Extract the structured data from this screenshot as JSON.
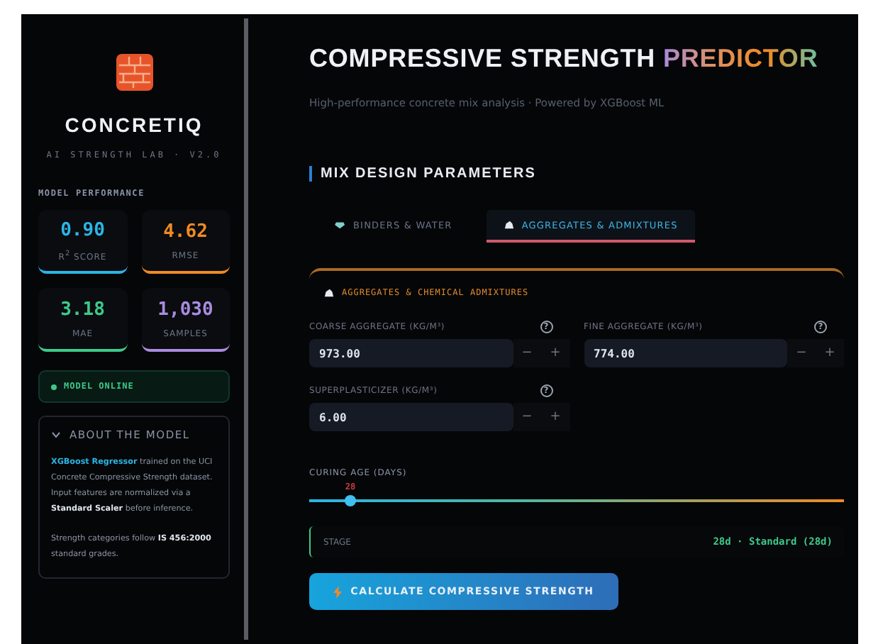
{
  "sidebar": {
    "logo": "CONCRETIQ",
    "tagline": "AI STRENGTH LAB · V2.0",
    "section_title": "MODEL PERFORMANCE",
    "metrics": [
      {
        "value": "0.90",
        "label": "R$^{2}$ SCORE",
        "color": "#2bb5e6"
      },
      {
        "value": "4.62",
        "label": "RMSE",
        "color": "#f08a24"
      },
      {
        "value": "3.18",
        "label": "MAE",
        "color": "#3ec98a"
      },
      {
        "value": "1,030",
        "label": "SAMPLES",
        "color": "#a98be0"
      }
    ],
    "status": {
      "label": "MODEL ONLINE",
      "online": true
    },
    "about": {
      "title": "ABOUT THE MODEL",
      "expanded": true,
      "paragraphs": [
        "**XGBoost Regressor** trained on the UCI Concrete Compressive Strength dataset. Input features are normalized via a **Standard Scaler** before inference.",
        "Strength categories follow **IS 456:2000** standard grades."
      ]
    }
  },
  "header": {
    "title": "COMPRESSIVE STRENGTH",
    "title_accent": "PREDICTOR",
    "subtitle": "High-performance concrete mix analysis · Powered by XGBoost ML"
  },
  "section_title": "MIX DESIGN PARAMETERS",
  "tabs": [
    {
      "label": "BINDERS & WATER",
      "selected": false,
      "kind": "gem"
    },
    {
      "label": "AGGREGATES & ADMIXTURES",
      "selected": true,
      "kind": "rock"
    }
  ],
  "panel": {
    "title": "AGGREGATES & CHEMICAL ADMIXTURES",
    "fields": [
      {
        "label": "COARSE AGGREGATE (KG/M³)",
        "help": "?",
        "value": "973.00",
        "decrement": "−",
        "increment": "+"
      },
      {
        "label": "FINE AGGREGATE (KG/M³)",
        "help": "?",
        "value": "774.00",
        "decrement": "−",
        "increment": "+"
      },
      {
        "label": "SUPERPLASTICIZER (KG/M³)",
        "help": "?",
        "value": "6.00",
        "decrement": "−",
        "increment": "+"
      }
    ]
  },
  "curing": {
    "label": "CURING AGE (DAYS)",
    "value": "28",
    "level": 0.077
  },
  "stage": {
    "label": "STAGE",
    "value": "28d · Standard (28d)"
  },
  "action": {
    "label": "CALCULATE COMPRESSIVE STRENGTH"
  }
}
